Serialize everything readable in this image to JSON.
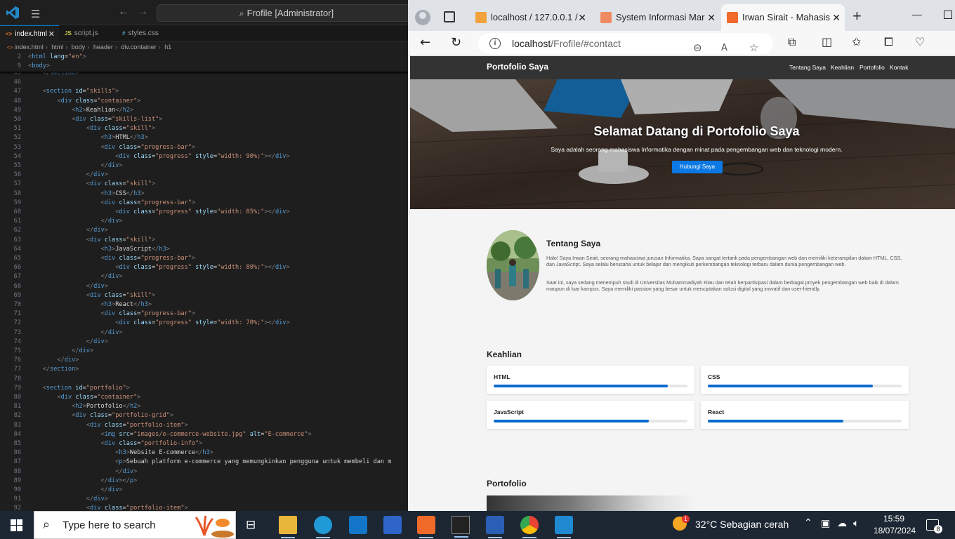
{
  "vscode": {
    "title": "Frofile [Administrator]",
    "tabs": [
      {
        "label": "index.html",
        "icon": "<>"
      },
      {
        "label": "script.js",
        "icon": "JS"
      },
      {
        "label": "styles.css",
        "icon": "#"
      }
    ],
    "breadcrumb": [
      "index.html",
      "html",
      "body",
      "header",
      "div.container",
      "h1"
    ]
  },
  "browser": {
    "tabs": [
      {
        "label": "localhost / 127.0.0.1 /"
      },
      {
        "label": "System Informasi Mar"
      },
      {
        "label": "Irwan Sirait - Mahasis"
      }
    ],
    "url_host": "localhost",
    "url_path": "/Frofile/#contact"
  },
  "site": {
    "logo": "Portofolio Saya",
    "nav": [
      "Tentang Saya",
      "Keahlian",
      "Portofolio",
      "Kontak"
    ],
    "hero_title": "Selamat Datang di Portofolio Saya",
    "hero_text": "Saya adalah seorang mahasiswa Informatika dengan minat pada pengembangan web dan teknologi modern.",
    "hero_button": "Hubungi Saya",
    "about_title": "Tentang Saya",
    "about_p1": "Halo! Saya Irwan Sirait, seorang mahasiswa jurusan Informatika. Saya sangat tertarik pada pengembangan web dan memiliki keterampilan dalam HTML, CSS, dan JavaScript. Saya selalu berusaha untuk belajar dan mengikuti perkembangan teknologi terbaru dalam dunia pengembangan web.",
    "about_p2": "Saat ini, saya sedang menempuh studi di Universitas Muhammadiyah Riau dan telah berpartisipasi dalam berbagai proyek pengembangan web baik di dalam maupun di luar kampus. Saya memiliki passion yang besar untuk menciptakan solusi digital yang inovatif dan user-friendly.",
    "skills_title": "Keahlian",
    "skills": [
      {
        "name": "HTML",
        "level": 0.9
      },
      {
        "name": "CSS",
        "level": 0.85
      },
      {
        "name": "JavaScript",
        "level": 0.8
      },
      {
        "name": "React",
        "level": 0.7
      }
    ],
    "portfolio_title": "Portofolio"
  },
  "taskbar": {
    "search_placeholder": "Type here to search",
    "weather": "32°C  Sebagian cerah",
    "weather_badge": "1",
    "time": "15:59",
    "date": "18/07/2024",
    "notif_count": "8"
  }
}
